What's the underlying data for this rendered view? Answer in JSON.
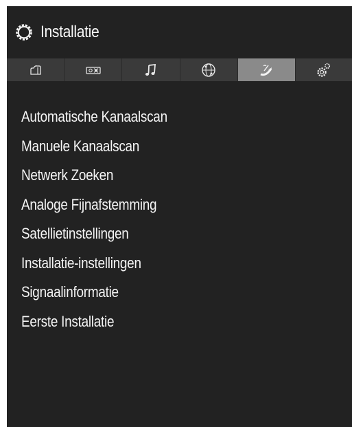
{
  "header": {
    "title": "Installatie",
    "icon": "gear-icon"
  },
  "tabs": [
    {
      "icon": "picture-icon",
      "active": false
    },
    {
      "icon": "sound-settings-icon",
      "active": false
    },
    {
      "icon": "music-note-icon",
      "active": false
    },
    {
      "icon": "network-globe-icon",
      "active": false
    },
    {
      "icon": "satellite-dish-icon",
      "active": true
    },
    {
      "icon": "system-gears-icon",
      "active": false
    }
  ],
  "menu": {
    "items": [
      "Automatische Kanaalscan",
      "Manuele Kanaalscan",
      "Netwerk Zoeken",
      "Analoge Fijnafstemming",
      "Satellietinstellingen",
      "Installatie-instellingen",
      "Signaalinformatie",
      "Eerste Installatie"
    ]
  },
  "colors": {
    "background": "#222222",
    "tab_bar": "#3a3a3a",
    "tab_active": "#8a8a8a",
    "text": "#f4f4f4"
  }
}
